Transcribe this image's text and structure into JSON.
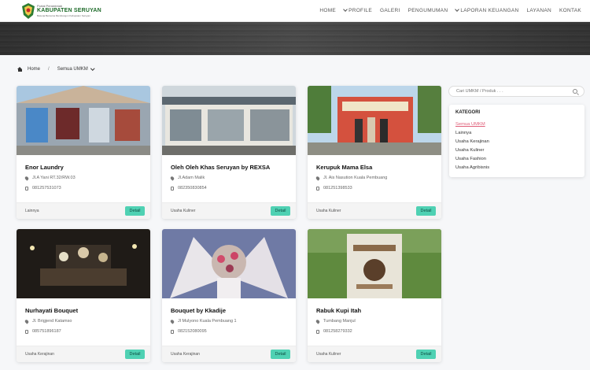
{
  "header": {
    "logo_small": "Portal Pemerintah",
    "logo_main": "KABUPATEN SERUYAN",
    "logo_tag": "Bekerja Bersama Membangun Kabupaten Seruyan",
    "nav": [
      "HOME",
      "PROFILE",
      "GALERI",
      "PENGUMUMAN",
      "LAPORAN KEUANGAN",
      "LAYANAN",
      "KONTAK"
    ]
  },
  "breadcrumb": {
    "home": "Home",
    "current": "Semua UMKM"
  },
  "search": {
    "placeholder": "Cari UMKM / Produk . . ."
  },
  "categories": {
    "title": "KATEGORI",
    "items": [
      "Semua UMKM",
      "Lainnya",
      "Usaha Kerajinan",
      "Usaha Kuliner",
      "Usaha Fashion",
      "Usaha Agribisnis"
    ]
  },
  "cards": [
    {
      "name": "Enor Laundry",
      "address": "Jl.A Yani RT.32/RW.03",
      "phone": "081257531073",
      "category": "Lainnya",
      "button": "Detail"
    },
    {
      "name": "Oleh Oleh Khas Seruyan by REXSA",
      "address": "Jl.Adam Malik",
      "phone": "082350830854",
      "category": "Usaha Kuliner",
      "button": "Detail"
    },
    {
      "name": "Kerupuk Mama Elsa",
      "address": "Jl. Ais Nasution Kuala Pembuang",
      "phone": "081251398533",
      "category": "Usaha Kuliner",
      "button": "Detail"
    },
    {
      "name": "Nurhayati Bouquet",
      "address": "Jl. Brigjend Katamso",
      "phone": "085751896187",
      "category": "Usaha Kerajinan",
      "button": "Detail"
    },
    {
      "name": "Bouquet by Kkadije",
      "address": "Jl Mulyono Kuala Pembuang 1",
      "phone": "082152080095",
      "category": "Usaha Kerajinan",
      "button": "Detail"
    },
    {
      "name": "Rabuk Kupi Itah",
      "address": "Tumbang Manjul",
      "phone": "081258279332",
      "category": "Usaha Kuliner",
      "button": "Detail"
    }
  ],
  "colors": {
    "accent": "#4fd1b3",
    "active_link": "#e0607a",
    "banner": "#3f3f3f"
  }
}
